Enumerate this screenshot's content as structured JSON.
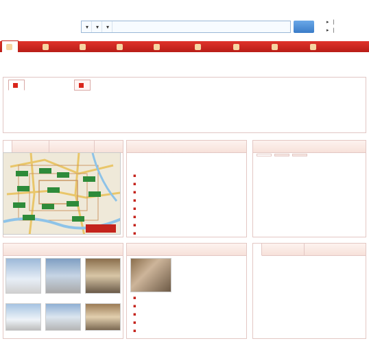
{
  "header": {
    "logo_text": "",
    "logo_sub": "",
    "city": "",
    "city_switch": "",
    "nav": [
      {
        "label": "",
        "active": true
      },
      {
        "label": "",
        "active": false
      },
      {
        "label": "",
        "active": false
      },
      {
        "label": "",
        "active": false
      },
      {
        "label": "",
        "active": false
      },
      {
        "label": "",
        "active": false
      },
      {
        "label": "",
        "active": false
      }
    ],
    "search": {
      "select_region": "",
      "select_type": "",
      "select_price": "",
      "keyword_placeholder": "",
      "button": ""
    },
    "publish": [
      {
        "label": "",
        "links": [
          "",
          ""
        ]
      },
      {
        "label": "",
        "links": [
          "",
          ""
        ]
      }
    ]
  },
  "mainnav": {
    "items": [
      "",
      "",
      "",
      "",
      "",
      "",
      "",
      "",
      "",
      ""
    ]
  },
  "cityline": {
    "label": "",
    "cities": [
      ""
    ],
    "right": [
      "",
      ""
    ]
  },
  "breadcrumb": {
    "home": "",
    "sep": "",
    "current": ""
  },
  "filter": {
    "tabs": [
      "",
      ""
    ],
    "rows": [
      {
        "key": "",
        "values": [
          "",
          "",
          "",
          "",
          "",
          "",
          "",
          "",
          "",
          "",
          "",
          "",
          "",
          "",
          "",
          ""
        ]
      },
      {
        "key": "",
        "values": [
          "",
          "",
          "",
          "",
          "",
          "",
          "",
          "",
          "",
          "",
          "",
          "",
          ""
        ]
      },
      {
        "key": "",
        "values": [
          "",
          "",
          "",
          "",
          "",
          ""
        ]
      },
      {
        "key": "",
        "values": [
          "",
          "",
          "",
          "",
          "",
          "",
          ""
        ]
      }
    ]
  },
  "map_panel": {
    "tabs": [
      "",
      "",
      ""
    ]
  },
  "express": {
    "title": "",
    "more": "",
    "headline": "",
    "subline": "",
    "items": [
      "",
      "",
      "",
      "",
      "",
      "",
      "",
      ""
    ]
  },
  "latest": {
    "title": "",
    "more": "",
    "tabs": [
      "",
      "",
      ""
    ],
    "columns": [
      "",
      "",
      ""
    ],
    "rows": [
      [
        "",
        "",
        ""
      ],
      [
        "",
        "",
        ""
      ],
      [
        "",
        "",
        ""
      ],
      [
        "",
        "",
        ""
      ],
      [
        "",
        "",
        ""
      ],
      [
        "",
        "",
        ""
      ],
      [
        "",
        "",
        ""
      ],
      [
        "",
        "",
        ""
      ],
      [
        "",
        "",
        ""
      ]
    ]
  },
  "recommend": {
    "title": "",
    "more": "",
    "items": [
      "",
      "",
      "",
      "",
      "",
      ""
    ]
  },
  "special": {
    "title": "",
    "more": "",
    "paragraph": "",
    "items": [
      "",
      "",
      "",
      "",
      ""
    ]
  },
  "monthly": {
    "tabs": [
      "",
      ""
    ],
    "more": "",
    "columns": [
      "",
      "",
      ""
    ],
    "rows": [
      [
        "",
        "",
        ""
      ],
      [
        "",
        "",
        ""
      ],
      [
        "",
        "",
        ""
      ],
      [
        "",
        "",
        ""
      ],
      [
        "",
        "",
        ""
      ],
      [
        "",
        "",
        ""
      ],
      [
        "",
        "",
        ""
      ],
      [
        "",
        "",
        ""
      ]
    ]
  }
}
